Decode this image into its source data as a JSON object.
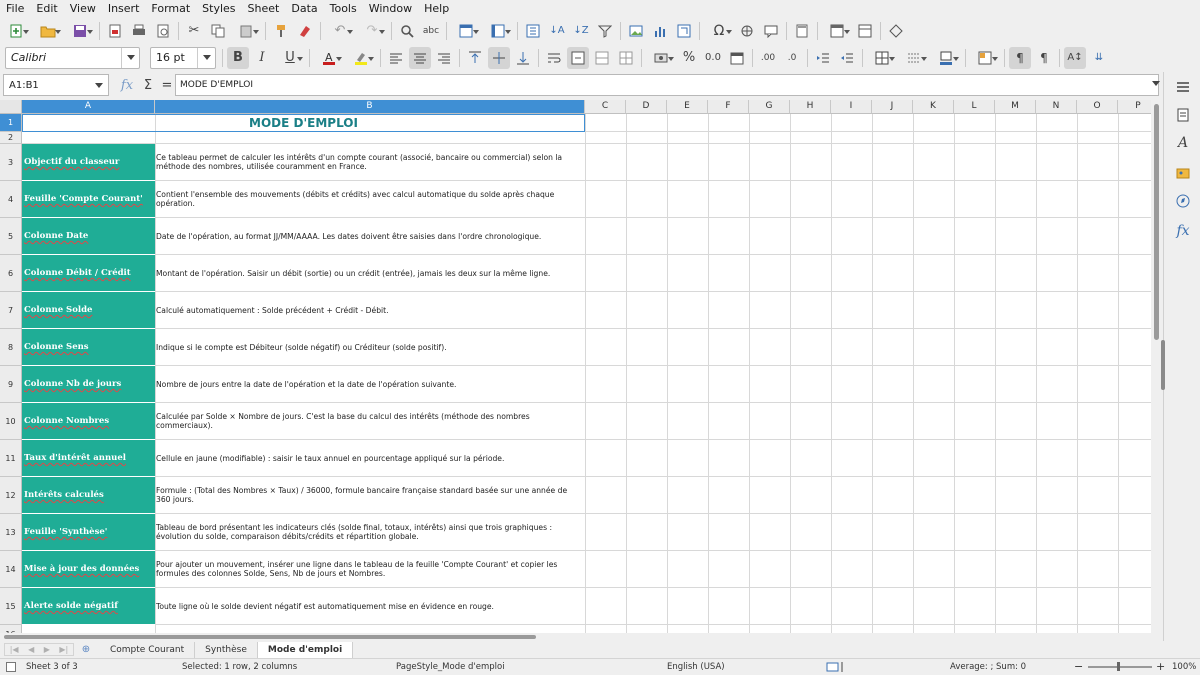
{
  "menu": [
    "File",
    "Edit",
    "View",
    "Insert",
    "Format",
    "Styles",
    "Sheet",
    "Data",
    "Tools",
    "Window",
    "Help"
  ],
  "toolbar": {
    "font_name": "Calibri",
    "font_size": "16 pt",
    "bold": "B",
    "italic": "I",
    "underline": "U",
    "percent": "%",
    "decimal": "0.0",
    "add_decimal": ".00",
    "remove_decimal": ".0"
  },
  "formula": {
    "name_box": "A1:B1",
    "content": "MODE D'EMPLOI"
  },
  "columns": [
    "A",
    "B",
    "C",
    "D",
    "E",
    "F",
    "G",
    "H",
    "I",
    "J",
    "K",
    "L",
    "M",
    "N",
    "O",
    "P"
  ],
  "rows": [
    "1",
    "2",
    "3",
    "4",
    "5",
    "6",
    "7",
    "8",
    "9",
    "10",
    "11",
    "12",
    "13",
    "14",
    "15",
    "16"
  ],
  "title": "MODE D'EMPLOI",
  "entries": [
    {
      "label": "Objectif du classeur",
      "text": "Ce tableau permet de calculer les intérêts d'un compte courant (associé, bancaire ou commercial) selon la méthode des nombres, utilisée couramment en France."
    },
    {
      "label": "Feuille 'Compte Courant'",
      "text": "Contient l'ensemble des mouvements (débits et crédits) avec calcul automatique du solde après chaque opération."
    },
    {
      "label": "Colonne Date",
      "text": "Date de l'opération, au format JJ/MM/AAAA. Les dates doivent être saisies dans l'ordre chronologique."
    },
    {
      "label": "Colonne Débit / Crédit",
      "text": "Montant de l'opération. Saisir un débit (sortie) ou un crédit (entrée), jamais les deux sur la même ligne."
    },
    {
      "label": "Colonne Solde",
      "text": "Calculé automatiquement : Solde précédent + Crédit - Débit."
    },
    {
      "label": "Colonne Sens",
      "text": "Indique si le compte est Débiteur (solde négatif) ou Créditeur (solde positif)."
    },
    {
      "label": "Colonne Nb de jours",
      "text": "Nombre de jours entre la date de l'opération et la date de l'opération suivante."
    },
    {
      "label": "Colonne Nombres",
      "text": "Calculée par Solde × Nombre de jours. C'est la base du calcul des intérêts (méthode des nombres commerciaux)."
    },
    {
      "label": "Taux d'intérêt annuel",
      "text": "Cellule en jaune (modifiable) : saisir le taux annuel en pourcentage appliqué sur la période."
    },
    {
      "label": "Intérêts calculés",
      "text": "Formule : (Total des Nombres × Taux) / 36000, formule bancaire française standard basée sur une année de 360 jours."
    },
    {
      "label": "Feuille 'Synthèse'",
      "text": "Tableau de bord présentant les indicateurs clés (solde final, totaux, intérêts) ainsi que trois graphiques : évolution du solde, comparaison débits/crédits et répartition globale."
    },
    {
      "label": "Mise à jour des données",
      "text": "Pour ajouter un mouvement, insérer une ligne dans le tableau de la feuille 'Compte Courant' et copier les formules des colonnes Solde, Sens, Nb de jours et Nombres."
    },
    {
      "label": "Alerte solde négatif",
      "text": "Toute ligne où le solde devient négatif est automatiquement mise en évidence en rouge."
    }
  ],
  "tabs": [
    "Compte Courant",
    "Synthèse",
    "Mode d'emploi"
  ],
  "active_tab": "Mode d'emploi",
  "status": {
    "sheet": "Sheet 3 of 3",
    "selection": "Selected: 1 row, 2 columns",
    "page_style": "PageStyle_Mode d'emploi",
    "language": "English (USA)",
    "summary": "Average: ; Sum: 0",
    "zoom": "100%",
    "zoom_minus": "−",
    "zoom_plus": "+"
  },
  "colors": {
    "label_fill": "#1fad96",
    "title_text": "#1a7f86",
    "selection": "#3f8fd4"
  },
  "icons": [
    "new-doc-icon",
    "open-icon",
    "save-icon",
    "export-pdf-icon",
    "print-icon",
    "print-preview-icon",
    "cut-icon",
    "copy-icon",
    "paste-icon",
    "clone-format-icon",
    "clear-format-icon",
    "undo-icon",
    "redo-icon",
    "find-icon",
    "spelling-icon",
    "row-icon",
    "column-icon",
    "sort-icon",
    "sort-asc-icon",
    "sort-desc-icon",
    "autofilter-icon",
    "image-icon",
    "chart-icon",
    "pivot-icon",
    "special-char-icon",
    "link-icon",
    "comment-icon",
    "header-footer-icon",
    "define-print-area-icon",
    "freeze-icon",
    "split-icon",
    "shapes-icon"
  ]
}
